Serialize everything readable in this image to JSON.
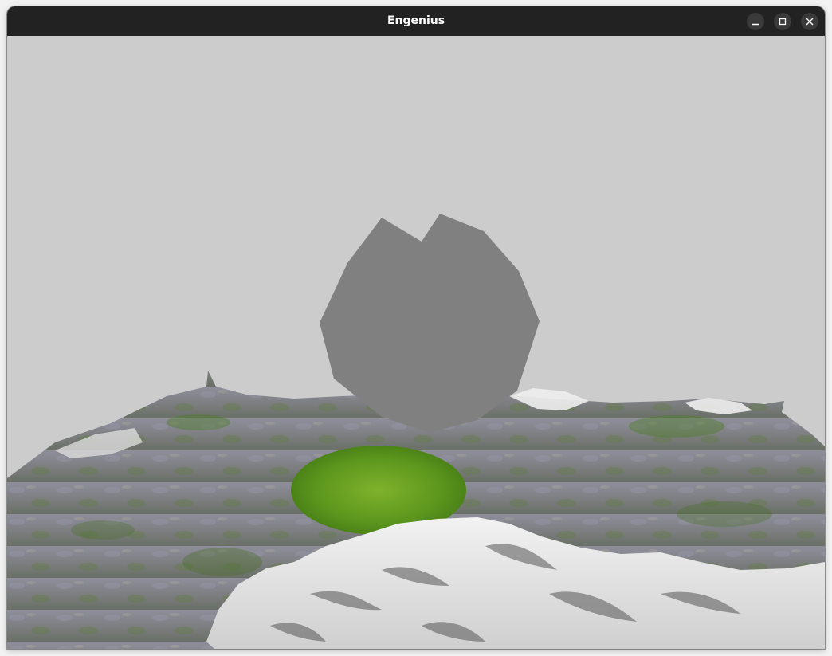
{
  "window": {
    "title": "Engenius",
    "controls": {
      "minimize": "minimize-icon",
      "maximize": "maximize-icon",
      "close": "close-icon"
    }
  },
  "scene": {
    "sky_color": "#cccccc",
    "object_color": "#808080",
    "grass_color": "#5a9a1e",
    "snow_color": "#e6e6e6",
    "rock_color": "#8a8a96"
  }
}
